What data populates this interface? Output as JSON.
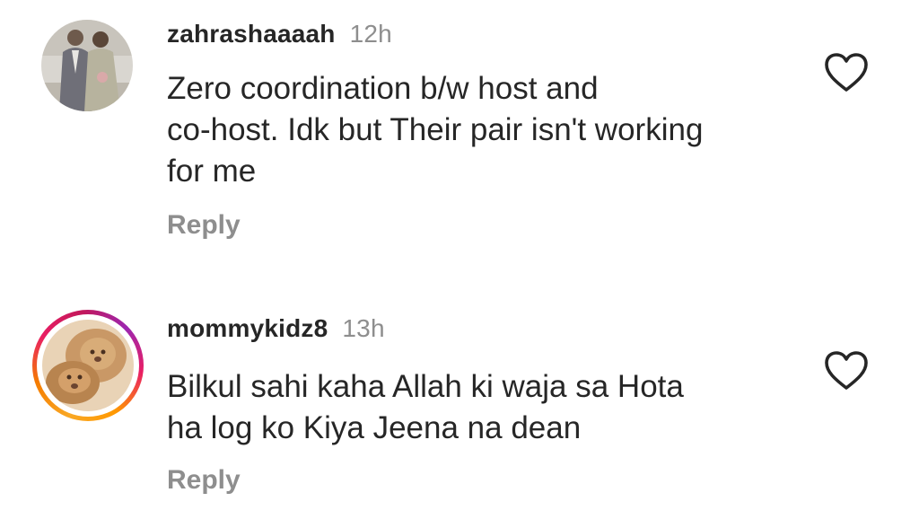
{
  "comments": [
    {
      "username": "zahrashaaaah",
      "time": "12h",
      "lines": [
        "Zero coordination b/w host and",
        "co-host. Idk but Their pair isn't working",
        "for me"
      ],
      "reply_label": "Reply",
      "avatar_icon": "couple-photo-avatar",
      "like_icon": "heart-outline-icon"
    },
    {
      "username": "mommykidz8",
      "time": "13h",
      "lines": [
        "Bilkul sahi kaha Allah ki waja sa Hota",
        "ha log ko Kiya Jeena na dean"
      ],
      "reply_label": "Reply",
      "avatar_icon": "lions-photo-avatar",
      "story_ring_colors": [
        "#f9a825",
        "#f57c00",
        "#e91e63",
        "#9c27b0"
      ],
      "like_icon": "heart-outline-icon"
    }
  ],
  "colors": {
    "text": "#262626",
    "secondary": "#8e8e8e",
    "background": "#ffffff"
  }
}
